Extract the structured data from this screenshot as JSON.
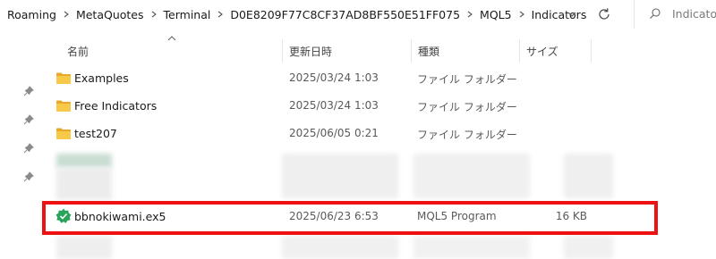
{
  "breadcrumb": [
    "Roaming",
    "MetaQuotes",
    "Terminal",
    "D0E8209F77C8CF37AD8BF550E51FF075",
    "MQL5",
    "Indicators"
  ],
  "search": {
    "placeholder": "Indicators"
  },
  "columns": {
    "name": "名前",
    "date": "更新日時",
    "type": "種類",
    "size": "サイズ"
  },
  "rows": [
    {
      "name": "Examples",
      "date": "2025/03/24 1:03",
      "type": "ファイル フォルダー",
      "size": "",
      "icon": "folder-icon"
    },
    {
      "name": "Free Indicators",
      "date": "2025/03/24 1:03",
      "type": "ファイル フォルダー",
      "size": "",
      "icon": "folder-icon"
    },
    {
      "name": "test207",
      "date": "2025/06/05 0:21",
      "type": "ファイル フォルダー",
      "size": "",
      "icon": "folder-icon"
    }
  ],
  "highlighted_file": {
    "name": "bbnokiwami.ex5",
    "date": "2025/06/23 6:53",
    "type": "MQL5 Program",
    "size": "16 KB",
    "icon": "mql5-ex5-icon"
  },
  "colors": {
    "highlight": "#ee1111",
    "folder": "#f5c242",
    "ex5_icon": "#1f9d55"
  }
}
